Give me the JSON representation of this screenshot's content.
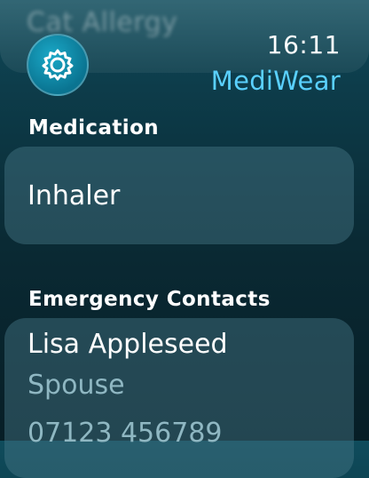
{
  "header": {
    "previous_item": "Cat Allergy",
    "time": "16:11",
    "app_name": "MediWear",
    "settings_icon": "gear-icon"
  },
  "medication": {
    "label": "Medication",
    "value": "Inhaler"
  },
  "emergency_contacts": {
    "label": "Emergency Contacts",
    "contacts": [
      {
        "name": "Lisa Appleseed",
        "relation": "Spouse",
        "phone": "07123 456789"
      }
    ]
  },
  "colors": {
    "accent": "#5ad0ff",
    "settings_button": "#0a7491",
    "secondary_text": "#8fb7c2"
  }
}
